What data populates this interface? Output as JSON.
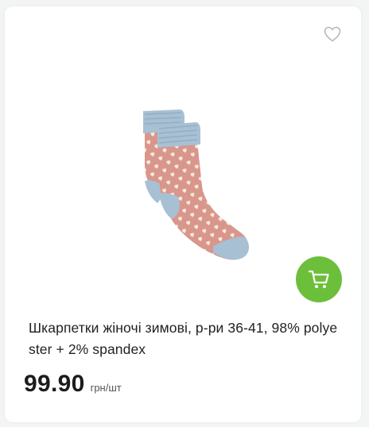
{
  "product": {
    "title": "Шкарпетки жіночі зимові, р-ри 36-41, 98% polyester + 2% spandex",
    "price": "99.90",
    "unit": "грн/шт",
    "image_alt": "socks-image"
  },
  "icons": {
    "favorite": "heart-outline-icon",
    "cart": "shopping-cart-icon"
  },
  "colors": {
    "accent": "#6cbf3b",
    "sock_pink": "#d9968c",
    "sock_blue": "#a8c0d4",
    "hearts": "#f6ead8"
  }
}
